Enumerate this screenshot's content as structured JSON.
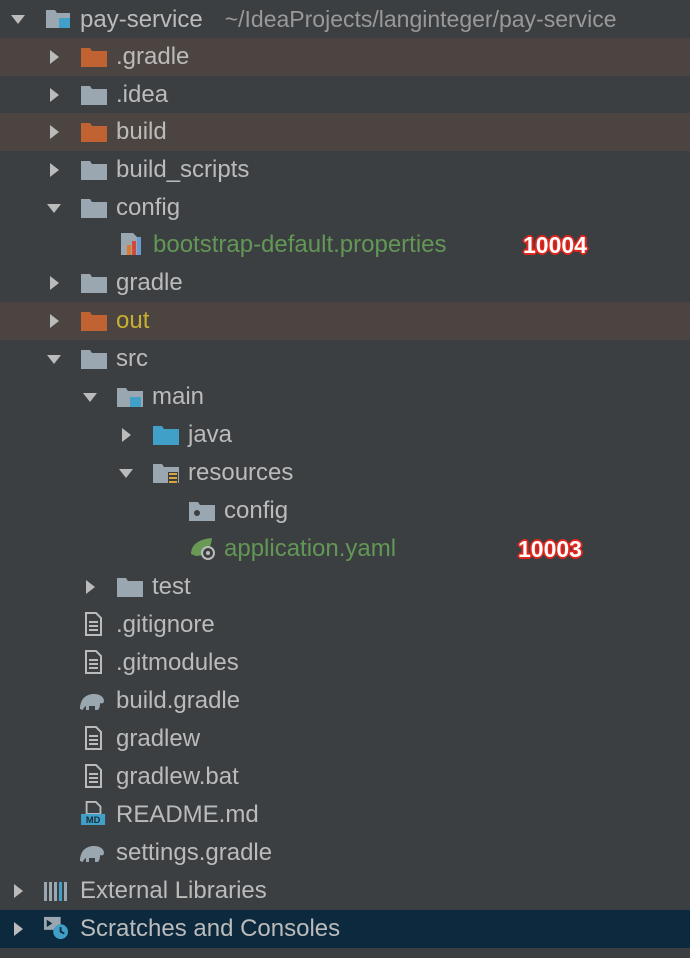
{
  "project": {
    "name": "pay-service",
    "path": "~/IdeaProjects/langinteger/pay-service"
  },
  "items": {
    "gradle_dot": ".gradle",
    "idea": ".idea",
    "build": "build",
    "build_scripts": "build_scripts",
    "config": "config",
    "bootstrap": "bootstrap-default.properties",
    "gradle": "gradle",
    "out": "out",
    "src": "src",
    "main": "main",
    "java": "java",
    "resources": "resources",
    "res_config": "config",
    "application": "application.yaml",
    "test": "test",
    "gitignore": ".gitignore",
    "gitmodules": ".gitmodules",
    "build_gradle": "build.gradle",
    "gradlew": "gradlew",
    "gradlew_bat": "gradlew.bat",
    "readme": "README.md",
    "settings_gradle": "settings.gradle",
    "external_libraries": "External Libraries",
    "scratches": "Scratches and Consoles"
  },
  "badges": {
    "bootstrap": "10004",
    "application": "10003"
  },
  "colors": {
    "background": "#3c3f41",
    "excluded_row": "#4b4441",
    "selected_row": "#0d293e",
    "folder": "#9aa7b0",
    "excluded_folder": "#c06232",
    "source_folder": "#40a0c8",
    "green_text": "#629755",
    "badge_red": "#e0261e"
  }
}
